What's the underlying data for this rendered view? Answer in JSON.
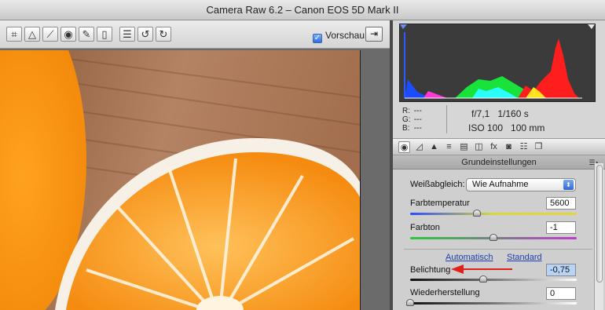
{
  "window": {
    "title": "Camera Raw 6.2 – Canon EOS 5D Mark II"
  },
  "toolbar": {
    "tools": [
      {
        "name": "crop-tool",
        "glyph": "⌗"
      },
      {
        "name": "straighten-tool",
        "glyph": "△"
      },
      {
        "name": "spot-removal-tool",
        "glyph": "⟋"
      },
      {
        "name": "red-eye-tool",
        "glyph": "◉"
      },
      {
        "name": "adjustment-brush-tool",
        "glyph": "✎"
      },
      {
        "name": "graduated-filter-tool",
        "glyph": "▯"
      },
      {
        "name": "preferences-tool",
        "glyph": "☰"
      },
      {
        "name": "rotate-left-tool",
        "glyph": "↺"
      },
      {
        "name": "rotate-right-tool",
        "glyph": "↻"
      }
    ],
    "preview_label": "Vorschau",
    "preview_checked": true,
    "fullscreen_glyph": "⇥"
  },
  "info": {
    "r_label": "R:",
    "r_value": "---",
    "g_label": "G:",
    "g_value": "---",
    "b_label": "B:",
    "b_value": "---",
    "aperture": "f/7,1",
    "shutter": "1/160 s",
    "iso": "ISO 100",
    "focal_length": "100 mm"
  },
  "panel_tabs": [
    {
      "name": "tab-basic",
      "glyph": "◉"
    },
    {
      "name": "tab-tone-curve",
      "glyph": "◿"
    },
    {
      "name": "tab-detail",
      "glyph": "▲"
    },
    {
      "name": "tab-hsl",
      "glyph": "≡"
    },
    {
      "name": "tab-split-toning",
      "glyph": "▤"
    },
    {
      "name": "tab-lens-corrections",
      "glyph": "◫"
    },
    {
      "name": "tab-effects",
      "glyph": "fx"
    },
    {
      "name": "tab-camera-calibration",
      "glyph": "◙"
    },
    {
      "name": "tab-presets",
      "glyph": "☷"
    },
    {
      "name": "tab-snapshots",
      "glyph": "❐"
    }
  ],
  "basic": {
    "section_title": "Grundeinstellungen",
    "white_balance_label": "Weißabgleich:",
    "white_balance_value": "Wie Aufnahme",
    "temperature_label": "Farbtemperatur",
    "temperature_value": "5600",
    "temperature_slider": 0.4,
    "tint_label": "Farbton",
    "tint_value": "-1",
    "tint_slider": 0.5,
    "auto_link": "Automatisch",
    "default_link": "Standard",
    "exposure_label": "Belichtung",
    "exposure_value": "-0,75",
    "exposure_slider": 0.44,
    "recovery_label": "Wiederherstellung",
    "recovery_value": "0",
    "recovery_slider": 0.0
  },
  "colors": {
    "annotation_arrow": "#e0201b",
    "accent": "#2f6ad1"
  }
}
